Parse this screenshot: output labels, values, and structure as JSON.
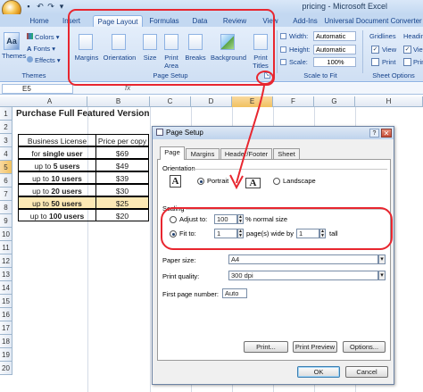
{
  "window": {
    "title": "pricing - Microsoft Excel"
  },
  "qat": [
    "save-icon",
    "undo-icon",
    "redo-icon",
    "dropdown-icon"
  ],
  "ribbon_tabs": [
    {
      "label": "Home"
    },
    {
      "label": "Insert"
    },
    {
      "label": "Page Layout"
    },
    {
      "label": "Formulas"
    },
    {
      "label": "Data"
    },
    {
      "label": "Review"
    },
    {
      "label": "View"
    },
    {
      "label": "Add-Ins"
    },
    {
      "label": "Universal Document Converter"
    }
  ],
  "themes": {
    "button": "Themes",
    "colors": "Colors",
    "fonts": "Fonts",
    "effects": "Effects",
    "group": "Themes"
  },
  "page_setup": {
    "margins": "Margins",
    "orientation": "Orientation",
    "size": "Size",
    "print_area1": "Print",
    "print_area2": "Area",
    "breaks": "Breaks",
    "background": "Background",
    "print_titles1": "Print",
    "print_titles2": "Titles",
    "group": "Page Setup"
  },
  "scale_to_fit": {
    "width_label": "Width:",
    "width_value": "Automatic",
    "height_label": "Height:",
    "height_value": "Automatic",
    "scale_label": "Scale:",
    "scale_value": "100%",
    "group": "Scale to Fit"
  },
  "sheet_options": {
    "gridlines": "Gridlines",
    "headings": "Heading",
    "view_label": "View",
    "print_label": "Print",
    "group": "Sheet Options"
  },
  "formula_bar": {
    "name_box": "E5",
    "fx": "fx"
  },
  "columns": [
    "A",
    "B",
    "C",
    "D",
    "E",
    "F",
    "G",
    "H"
  ],
  "rows": [
    "1",
    "2",
    "3",
    "4",
    "5",
    "6",
    "7",
    "8",
    "9",
    "10",
    "11",
    "12",
    "13",
    "14",
    "15",
    "16",
    "17",
    "18",
    "19",
    "20"
  ],
  "sheet": {
    "title": "Purchase Full Featured Version",
    "header": {
      "license": "Business License",
      "price": "Price per copy"
    },
    "rows": [
      {
        "pre": "for ",
        "bold": "single user",
        "price": "$69"
      },
      {
        "pre": "up to ",
        "bold": "5 users",
        "price": "$49"
      },
      {
        "pre": "up to ",
        "bold": "10 users",
        "price": "$39"
      },
      {
        "pre": "up to ",
        "bold": "20 users",
        "price": "$30"
      },
      {
        "pre": "up to ",
        "bold": "50 users",
        "price": "$25"
      },
      {
        "pre": "up to ",
        "bold": "100 users",
        "price": "$20"
      }
    ]
  },
  "dialog": {
    "title": "Page Setup",
    "help": "?",
    "close": "✕",
    "tabs": [
      {
        "label": "Page"
      },
      {
        "label": "Margins"
      },
      {
        "label": "Header/Footer"
      },
      {
        "label": "Sheet"
      }
    ],
    "orientation_label": "Orientation",
    "portrait": "Portrait",
    "landscape": "Landscape",
    "scaling_label": "Scaling",
    "adjust_to": "Adjust to:",
    "adjust_value": "100",
    "normal_size": "% normal size",
    "fit_to": "Fit to:",
    "fit_wide_value": "1",
    "pages_wide_by": "page(s) wide by",
    "fit_tall_value": "1",
    "tall": "tall",
    "paper_size_label": "Paper size:",
    "paper_size_value": "A4",
    "print_quality_label": "Print quality:",
    "print_quality_value": "300 dpi",
    "first_page_label": "First page number:",
    "first_page_value": "Auto",
    "print_btn": "Print...",
    "preview_btn": "Print Preview",
    "options_btn": "Options...",
    "ok_btn": "OK",
    "cancel_btn": "Cancel"
  },
  "colors": {
    "annotation": "#e8262f",
    "ribbon_text": "#15428b",
    "selected_row": "#fde9b5"
  }
}
